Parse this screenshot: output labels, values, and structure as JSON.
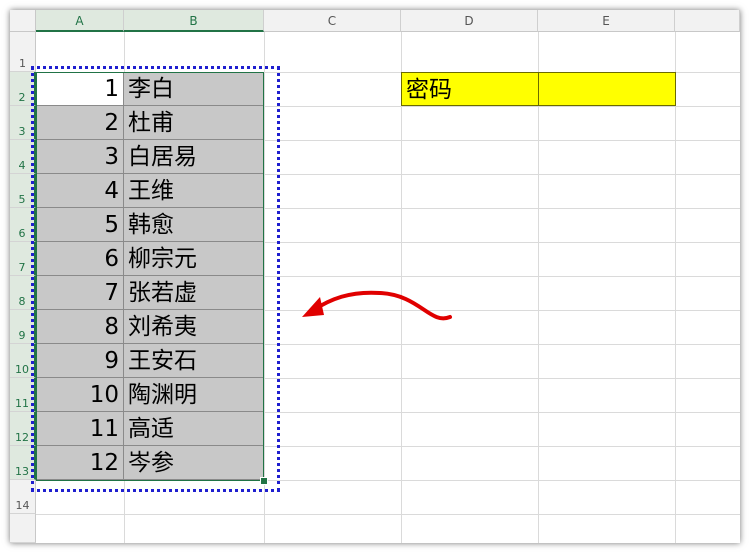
{
  "columns": [
    "A",
    "B",
    "C",
    "D",
    "E"
  ],
  "rows": [
    "1",
    "2",
    "3",
    "4",
    "5",
    "6",
    "7",
    "8",
    "9",
    "10",
    "11",
    "12",
    "13",
    "14"
  ],
  "data_rows": [
    {
      "num": "1",
      "name": "李白"
    },
    {
      "num": "2",
      "name": "杜甫"
    },
    {
      "num": "3",
      "name": "白居易"
    },
    {
      "num": "4",
      "name": "王维"
    },
    {
      "num": "5",
      "name": "韩愈"
    },
    {
      "num": "6",
      "name": "柳宗元"
    },
    {
      "num": "7",
      "name": "张若虚"
    },
    {
      "num": "8",
      "name": "刘希夷"
    },
    {
      "num": "9",
      "name": "王安石"
    },
    {
      "num": "10",
      "name": "陶渊明"
    },
    {
      "num": "11",
      "name": "高适"
    },
    {
      "num": "12",
      "name": "岑参"
    }
  ],
  "password_label": "密码",
  "password_value": "",
  "colors": {
    "header_bg": "#f2f2f2",
    "selection_green": "#217346",
    "copy_marquee_blue": "#1f1fcf",
    "range_fill_gray": "#c8c8c8",
    "password_fill_yellow": "#ffff00",
    "arrow_red": "#e00000"
  },
  "icons": {
    "annotation": "red-curved-arrow-icon"
  }
}
